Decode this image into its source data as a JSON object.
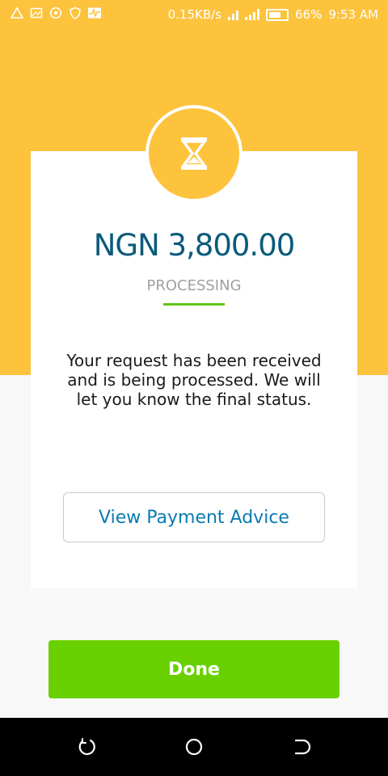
{
  "status_bar": {
    "network_speed": "0.15KB/s",
    "battery": "66%",
    "time": "9:53 AM",
    "left_icons": [
      "alert-triangle-icon",
      "image-icon",
      "whatsapp-icon",
      "shield-icon",
      "activity-icon"
    ]
  },
  "transaction": {
    "amount": "NGN 3,800.00",
    "status": "PROCESSING",
    "message": "Your request has been received and is being processed. We will let you know the final status.",
    "icon": "hourglass-icon"
  },
  "buttons": {
    "view_advice": "View Payment Advice",
    "done": "Done"
  },
  "navigation": {
    "items": [
      "back-icon",
      "home-icon",
      "recent-apps-icon"
    ]
  },
  "colors": {
    "header_bg": "#fdc33d",
    "amount_text": "#0a5a7a",
    "accent_green": "#69d000",
    "link_blue": "#0b7bb0"
  }
}
